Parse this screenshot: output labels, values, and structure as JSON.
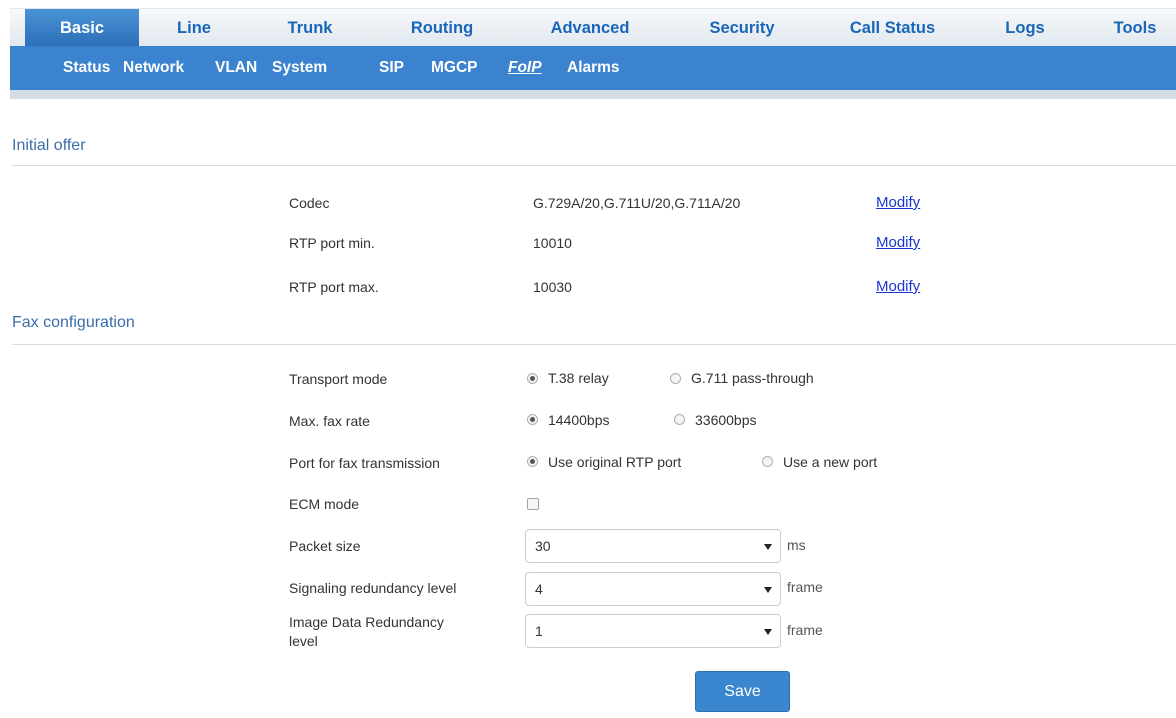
{
  "nav": {
    "tabs": [
      {
        "label": "Basic"
      },
      {
        "label": "Line"
      },
      {
        "label": "Trunk"
      },
      {
        "label": "Routing"
      },
      {
        "label": "Advanced"
      },
      {
        "label": "Security"
      },
      {
        "label": "Call Status"
      },
      {
        "label": "Logs"
      },
      {
        "label": "Tools"
      }
    ],
    "active_tab": "Basic"
  },
  "subnav": {
    "items": [
      {
        "label": "Status"
      },
      {
        "label": "Network"
      },
      {
        "label": "VLAN"
      },
      {
        "label": "System"
      },
      {
        "label": "SIP"
      },
      {
        "label": "MGCP"
      },
      {
        "label": "FoIP"
      },
      {
        "label": "Alarms"
      }
    ],
    "active_item": "FoIP"
  },
  "initial_offer": {
    "title": "Initial offer",
    "rows": [
      {
        "label": "Codec",
        "value": "G.729A/20,G.711U/20,G.711A/20",
        "action": "Modify"
      },
      {
        "label": "RTP port min.",
        "value": "10010",
        "action": "Modify"
      },
      {
        "label": "RTP port max.",
        "value": "10030",
        "action": "Modify"
      }
    ]
  },
  "fax": {
    "title": "Fax configuration",
    "transport_mode": {
      "label": "Transport mode",
      "options": [
        "T.38 relay",
        "G.711 pass-through"
      ],
      "selected": "T.38 relay"
    },
    "max_fax_rate": {
      "label": "Max. fax rate",
      "options": [
        "14400bps",
        "33600bps"
      ],
      "selected": "14400bps"
    },
    "port": {
      "label": "Port for fax transmission",
      "options": [
        "Use original RTP port",
        "Use a new port"
      ],
      "selected": "Use original RTP port"
    },
    "ecm": {
      "label": "ECM mode",
      "checked": false
    },
    "packet_size": {
      "label": "Packet size",
      "value": "30",
      "unit": "ms"
    },
    "signaling_redundancy": {
      "label": "Signaling redundancy level",
      "value": "4",
      "unit": "frame"
    },
    "image_redundancy": {
      "label_line1": "Image Data Redundancy",
      "label_line2": "level",
      "value": "1",
      "unit": "frame"
    }
  },
  "save_label": "Save",
  "colors": {
    "accent": "#3b83cf",
    "link": "#1a35d6",
    "section_title": "#3b6ea8"
  }
}
